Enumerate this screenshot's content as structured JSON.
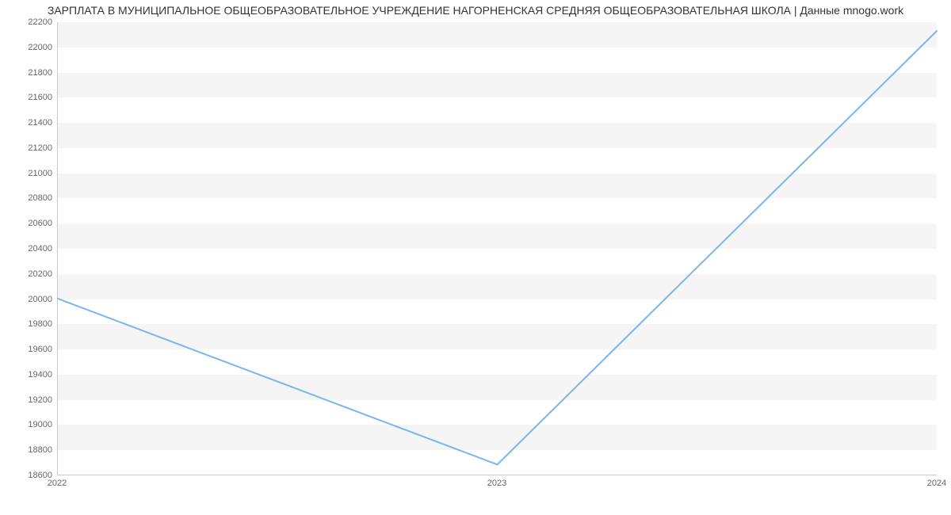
{
  "chart_data": {
    "type": "line",
    "title": "ЗАРПЛАТА В МУНИЦИПАЛЬНОЕ ОБЩЕОБРАЗОВАТЕЛЬНОЕ УЧРЕЖДЕНИЕ НАГОРНЕНСКАЯ СРЕДНЯЯ ОБЩЕОБРАЗОВАТЕЛЬНАЯ ШКОЛА | Данные mnogo.work",
    "xlabel": "",
    "ylabel": "",
    "x_categories": [
      "2022",
      "2023",
      "2024"
    ],
    "y_ticks": [
      18600,
      18800,
      19000,
      19200,
      19400,
      19600,
      19800,
      20000,
      20200,
      20400,
      20600,
      20800,
      21000,
      21200,
      21400,
      21600,
      21800,
      22000,
      22200
    ],
    "ylim": [
      18600,
      22200
    ],
    "series": [
      {
        "name": "Зарплата",
        "color": "#7cb5ec",
        "values": [
          20000,
          18680,
          22130
        ]
      }
    ],
    "grid": {
      "alternating_bands": true
    },
    "legend": {
      "visible": false
    }
  }
}
